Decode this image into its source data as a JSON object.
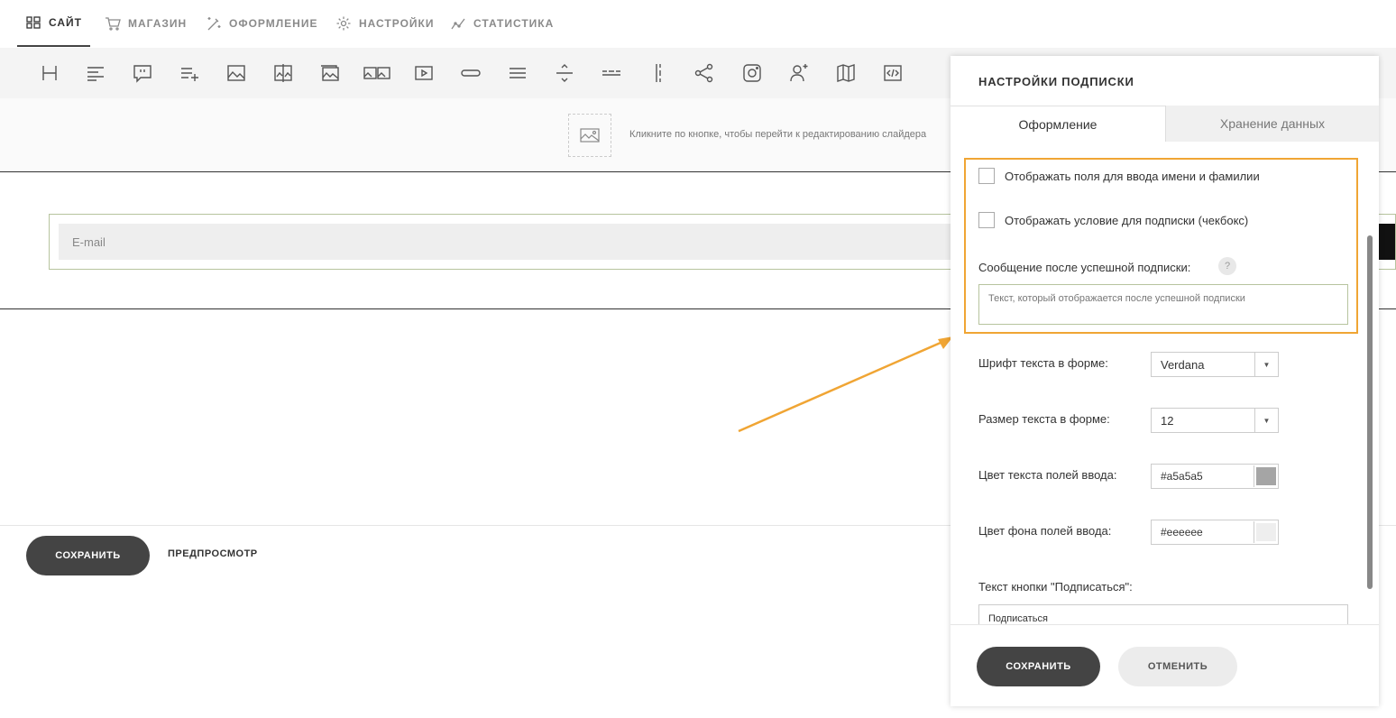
{
  "nav": {
    "items": [
      {
        "label": "САЙТ",
        "icon": "grid-icon"
      },
      {
        "label": "МАГАЗИН",
        "icon": "cart-icon"
      },
      {
        "label": "ОФОРМЛЕНИЕ",
        "icon": "magic-brush-icon"
      },
      {
        "label": "НАСТРОЙКИ",
        "icon": "gear-icon"
      },
      {
        "label": "СТАТИСТИКА",
        "icon": "line-chart-icon"
      }
    ],
    "active": "САЙТ"
  },
  "toolbar": {
    "tools": [
      "heading-icon",
      "text-align-icon",
      "quote-icon",
      "list-add-icon",
      "image-icon",
      "image-compare-icon",
      "gallery-icon",
      "multi-image-icon",
      "video-icon",
      "button-icon",
      "lines-icon",
      "divider-icon",
      "dashed-line-icon",
      "vertical-divider-icon",
      "share-icon",
      "instagram-icon",
      "subscribe-user-icon",
      "map-icon",
      "code-icon"
    ]
  },
  "slider": {
    "hint": "Кликните по кнопке, чтобы перейти к редактированию слайдера"
  },
  "subscribe_form": {
    "email_placeholder": "E-mail"
  },
  "page_actions": {
    "save_label": "СОХРАНИТЬ",
    "preview_label": "ПРЕДПРОСМОТР"
  },
  "panel": {
    "title": "НАСТРОЙКИ ПОДПИСКИ",
    "tabs": [
      "Оформление",
      "Хранение данных"
    ],
    "active_tab": "Оформление",
    "checkbox_name_fields": "Отображать поля для ввода имени и фамилии",
    "checkbox_condition": "Отображать условие для подписки (чекбокс)",
    "success_message_label": "Сообщение после успешной подписки:",
    "help_mark": "?",
    "success_message_placeholder": "Текст, который отображается после успешной подписки",
    "font_label": "Шрифт текста в форме:",
    "font_value": "Verdana",
    "size_label": "Размер текста в форме:",
    "size_value": "12",
    "input_text_color_label": "Цвет текста полей ввода:",
    "input_text_color_value": "#a5a5a5",
    "input_bg_color_label": "Цвет фона полей ввода:",
    "input_bg_color_value": "#eeeeee",
    "button_text_label": "Текст кнопки \"Подписаться\":",
    "button_text_value": "Подписаться",
    "save_label": "СОХРАНИТЬ",
    "cancel_label": "ОТМЕНИТЬ"
  },
  "colors": {
    "accent_highlight": "#f0a534",
    "dark_button": "#444444"
  }
}
